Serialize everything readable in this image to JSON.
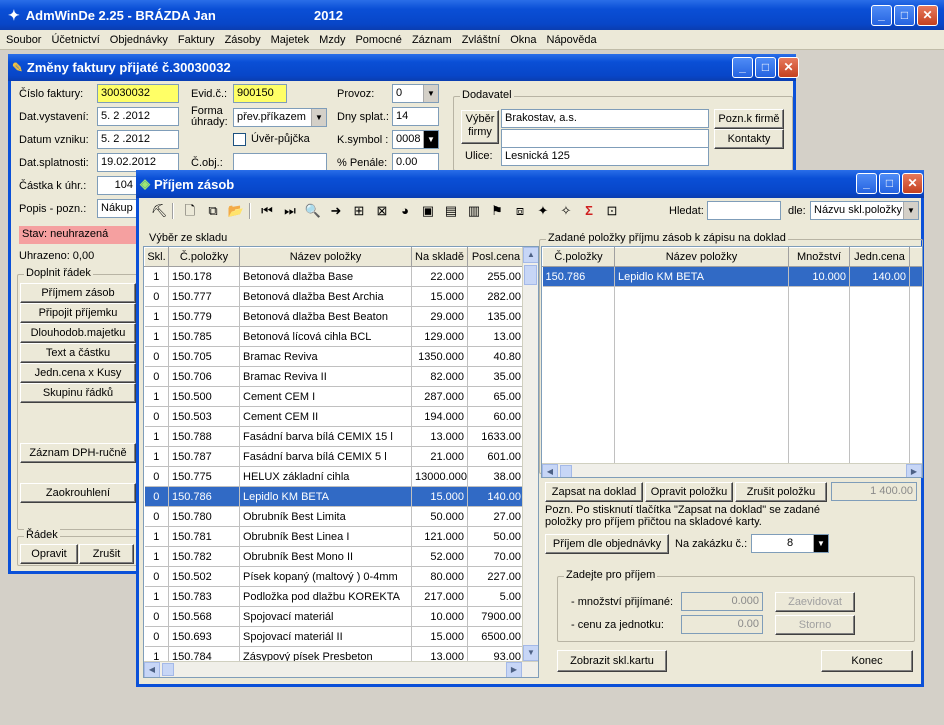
{
  "app": {
    "title": "AdmWinDe 2.25 - BRÁZDA Jan",
    "year": "2012"
  },
  "menu": [
    "Soubor",
    "Účetnictví",
    "Objednávky",
    "Faktury",
    "Zásoby",
    "Majetek",
    "Mzdy",
    "Pomocné",
    "Záznam",
    "Zvláštní",
    "Okna",
    "Nápověda"
  ],
  "invoice": {
    "title": "Změny faktury přijaté č.30030032",
    "cislo_label": "Číslo faktury:",
    "cislo": "30030032",
    "evid_label": "Evid.č.:",
    "evid": "900150",
    "provoz_label": "Provoz:",
    "provoz": "0",
    "vystaveni_label": "Dat.vystavení:",
    "vystaveni": "5. 2 .2012",
    "forma_label": "Forma\núhrady:",
    "forma": "přev.příkazem",
    "splat_label": "Dny splat.:",
    "splat": "14",
    "vzniku_label": "Datum vzniku:",
    "vzniku": "5. 2 .2012",
    "uver_label": "Úvěr-půjčka",
    "ksymbol_label": "K.symbol :",
    "ksymbol": "0008",
    "datsplat_label": "Dat.splatnosti:",
    "datsplat": "19.02.2012",
    "cobj_label": "Č.obj.:",
    "penale_label": "% Penále:",
    "penale": "0.00",
    "castka_label": "Částka k úhr.:",
    "castka": "104",
    "popis_label": "Popis - pozn.:",
    "popis": "Nákup",
    "stav": "Stav: neuhrazená",
    "uhrazeno": "Uhrazeno: 0,00",
    "doplnit_title": "Doplnit řádek",
    "doplnit_buttons": [
      "Příjmem zásob",
      "Připojit příjemku",
      "Dlouhodob.majetku",
      "Text a částku",
      "Jedn.cena x Kusy",
      "Skupinu řádků"
    ],
    "dph_btn": "Záznam DPH-ručně",
    "zaokr_btn": "Zaokrouhlení",
    "radek_title": "Řádek",
    "opravit": "Opravit",
    "zrusit": "Zrušit",
    "dodavatel_title": "Dodavatel",
    "vyber_firmy": "Výběr\nfirmy",
    "firma": "Brakostav, a.s.",
    "ulice_label": "Ulice:",
    "ulice": "Lesnická 125",
    "pozn_firme": "Pozn.k firmě",
    "kontakty": "Kontakty"
  },
  "receipt": {
    "title": "Příjem zásob",
    "hledat_label": "Hledat:",
    "hledat": "",
    "dle_label": "dle:",
    "dle": "Názvu skl.položky",
    "left_title": "Výběr ze skladu",
    "left_headers": [
      "Skl.",
      "Č.položky",
      "Název položky",
      "Na skladě",
      "Posl.cena"
    ],
    "left_rows": [
      [
        "1",
        "150.178",
        "Betonová dlažba Base",
        "22.000",
        "255.00"
      ],
      [
        "0",
        "150.777",
        "Betonová dlažba Best Archia",
        "15.000",
        "282.00"
      ],
      [
        "1",
        "150.779",
        "Betonová dlažba Best Beaton",
        "29.000",
        "135.00"
      ],
      [
        "1",
        "150.785",
        "Betonová lícová cihla BCL",
        "129.000",
        "13.00"
      ],
      [
        "0",
        "150.705",
        "Bramac Reviva",
        "1350.000",
        "40.80"
      ],
      [
        "0",
        "150.706",
        "Bramac Reviva II",
        "82.000",
        "35.00"
      ],
      [
        "1",
        "150.500",
        "Cement CEM I",
        "287.000",
        "65.00"
      ],
      [
        "0",
        "150.503",
        "Cement CEM II",
        "194.000",
        "60.00"
      ],
      [
        "1",
        "150.788",
        "Fasádní barva bílá CEMIX 15 l",
        "13.000",
        "1633.00"
      ],
      [
        "1",
        "150.787",
        "Fasádní barva bílá CEMIX 5 l",
        "21.000",
        "601.00"
      ],
      [
        "0",
        "150.775",
        "HELUX základní cihla",
        "13000.000",
        "38.00"
      ],
      [
        "0",
        "150.786",
        "Lepidlo KM BETA",
        "15.000",
        "140.00"
      ],
      [
        "0",
        "150.780",
        "Obrubník Best Limita",
        "50.000",
        "27.00"
      ],
      [
        "1",
        "150.781",
        "Obrubník Best Linea I",
        "121.000",
        "50.00"
      ],
      [
        "1",
        "150.782",
        "Obrubník Best Mono II",
        "52.000",
        "70.00"
      ],
      [
        "0",
        "150.502",
        "Písek kopaný (maltový ) 0-4mm",
        "80.000",
        "227.00"
      ],
      [
        "1",
        "150.783",
        "Podložka pod dlažbu KOREKTA",
        "217.000",
        "5.00"
      ],
      [
        "0",
        "150.568",
        "Spojovací materiál",
        "10.000",
        "7900.00"
      ],
      [
        "0",
        "150.693",
        "Spojovací materiál II",
        "15.000",
        "6500.00"
      ],
      [
        "1",
        "150.784",
        "Zásypový písek Presbeton",
        "13.000",
        "93.00"
      ]
    ],
    "right_title": "Zadané položky příjmu zásob k zápisu na doklad",
    "right_headers": [
      "Č.položky",
      "Název položky",
      "Množství",
      "Jedn.cena"
    ],
    "right_rows": [
      [
        "150.786",
        "Lepidlo KM BETA",
        "10.000",
        "140.00"
      ]
    ],
    "zapsat": "Zapsat na doklad",
    "opravit_pol": "Opravit položku",
    "zrusit_pol": "Zrušit položku",
    "total": "1 400.00",
    "note": "Pozn. Po stisknutí tlačítka \"Zapsat na doklad\" se zadané položky pro příjem přičtou na skladové karty.",
    "prijem_obj": "Příjem dle objednávky",
    "zakazka_label": "Na zakázku č.:",
    "zakazka": "8",
    "zadejte_title": "Zadejte pro příjem",
    "mnozstvi_label": "- množství přijímané:",
    "mnozstvi": "0.000",
    "cena_label": "- cenu za jednotku:",
    "cena": "0.00",
    "zaevidovat": "Zaevidovat",
    "storno": "Storno",
    "zobrazit": "Zobrazit skl.kartu",
    "konec": "Konec"
  }
}
